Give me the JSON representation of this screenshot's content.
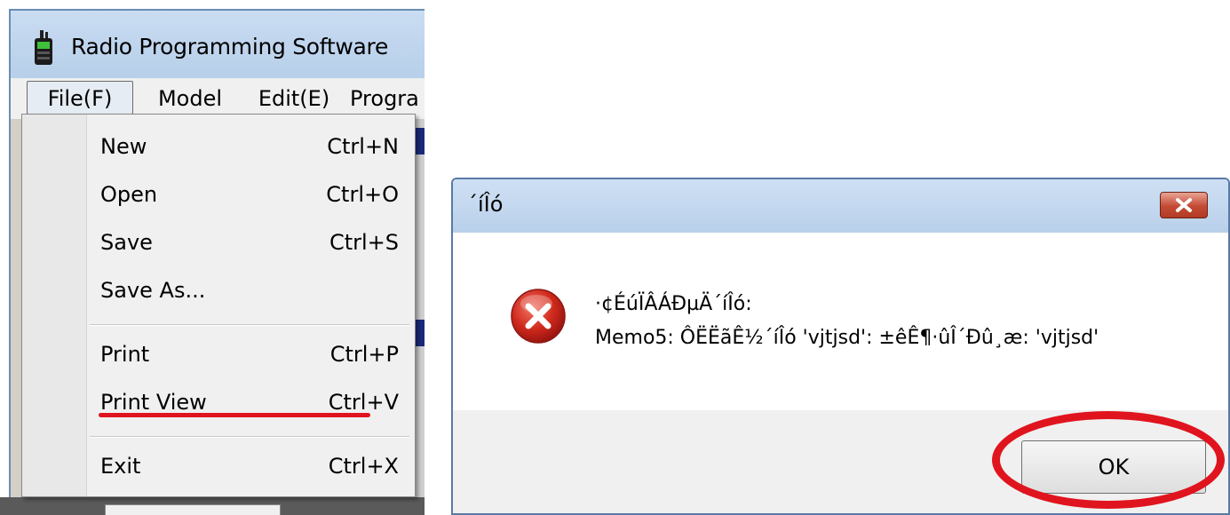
{
  "main_window": {
    "title": "Radio Programming Software",
    "menubar": {
      "file": "File(F)",
      "model": "Model",
      "edit": "Edit(E)",
      "program": "Progra"
    },
    "file_menu": {
      "items": [
        {
          "label": "New",
          "shortcut": "Ctrl+N"
        },
        {
          "label": "Open",
          "shortcut": "Ctrl+O"
        },
        {
          "label": "Save",
          "shortcut": "Ctrl+S"
        },
        {
          "label": "Save As...",
          "shortcut": ""
        },
        {
          "label": "Print",
          "shortcut": "Ctrl+P"
        },
        {
          "label": "Print View",
          "shortcut": "Ctrl+V"
        },
        {
          "label": "Exit",
          "shortcut": "Ctrl+X"
        }
      ],
      "highlighted_item": "Print View"
    }
  },
  "error_dialog": {
    "title": "´íÎó",
    "message_line1": "·¢ÉúÏÂÁÐµÄ´íÎó:",
    "message_line2": "Memo5: ÔËËãÊ½´íÎó 'vjtjsd': ±êÊ¶·ûÎ´Ðû¸æ: 'vjtjsd'",
    "ok_label": "OK",
    "icon": "error-icon"
  },
  "colors": {
    "annotation_red": "#e0141e",
    "close_button": "#c44a34",
    "titlebar": "#b9d0ea"
  }
}
